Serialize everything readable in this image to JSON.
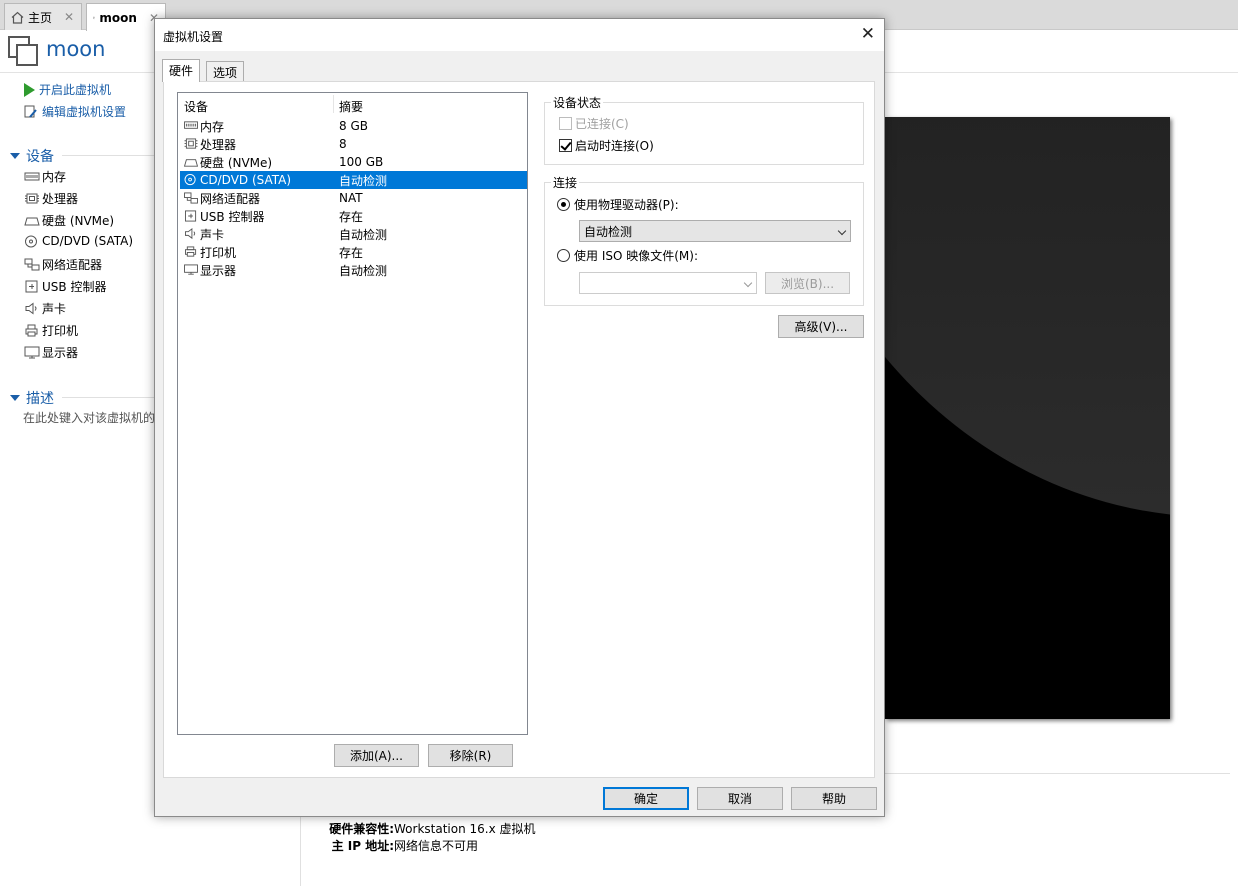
{
  "tabs": [
    {
      "label": "主页",
      "icon": "home-icon"
    },
    {
      "label": "moon",
      "icon": "vm-icon"
    }
  ],
  "vm": {
    "name": "moon"
  },
  "actions": {
    "power_on": "开启此虚拟机",
    "edit_settings": "编辑虚拟机设置"
  },
  "sidebar": {
    "devices_heading": "设备",
    "devices": [
      "内存",
      "处理器",
      "硬盘 (NVMe)",
      "CD/DVD (SATA)",
      "网络适配器",
      "USB 控制器",
      "声卡",
      "打印机",
      "显示器"
    ],
    "desc_heading": "描述",
    "desc_text": "在此处键入对该虚拟机的"
  },
  "details": {
    "compat_label": "硬件兼容性:",
    "compat_value": "Workstation 16.x 虚拟机",
    "ip_label": "主 IP 地址:",
    "ip_value": "网络信息不可用"
  },
  "dialog": {
    "title": "虚拟机设置",
    "tabs": [
      "硬件",
      "选项"
    ],
    "list_headers": {
      "device": "设备",
      "summary": "摘要"
    },
    "devices": [
      {
        "name": "内存",
        "summary": "8 GB",
        "icon": "memory-icon"
      },
      {
        "name": "处理器",
        "summary": "8",
        "icon": "cpu-icon"
      },
      {
        "name": "硬盘 (NVMe)",
        "summary": "100 GB",
        "icon": "harddisk-icon"
      },
      {
        "name": "CD/DVD (SATA)",
        "summary": "自动检测",
        "icon": "cdrom-icon",
        "selected": true
      },
      {
        "name": "网络适配器",
        "summary": "NAT",
        "icon": "network-icon"
      },
      {
        "name": "USB 控制器",
        "summary": "存在",
        "icon": "usb-icon"
      },
      {
        "name": "声卡",
        "summary": "自动检测",
        "icon": "speaker-icon"
      },
      {
        "name": "打印机",
        "summary": "存在",
        "icon": "printer-icon"
      },
      {
        "name": "显示器",
        "summary": "自动检测",
        "icon": "monitor-icon"
      }
    ],
    "add_button": "添加(A)...",
    "remove_button": "移除(R)",
    "device_status": {
      "heading": "设备状态",
      "connected": "已连接(C)",
      "connect_at_power_on": "启动时连接(O)"
    },
    "connection": {
      "heading": "连接",
      "use_physical": "使用物理驱动器(P):",
      "physical_value": "自动检测",
      "use_iso": "使用 ISO 映像文件(M):",
      "iso_value": "",
      "browse_button": "浏览(B)..."
    },
    "advanced_button": "高级(V)...",
    "ok_button": "确定",
    "cancel_button": "取消",
    "help_button": "帮助"
  },
  "colors": {
    "accent": "#0078d7",
    "link": "#1a5ea8",
    "play": "#2e9b2e"
  }
}
